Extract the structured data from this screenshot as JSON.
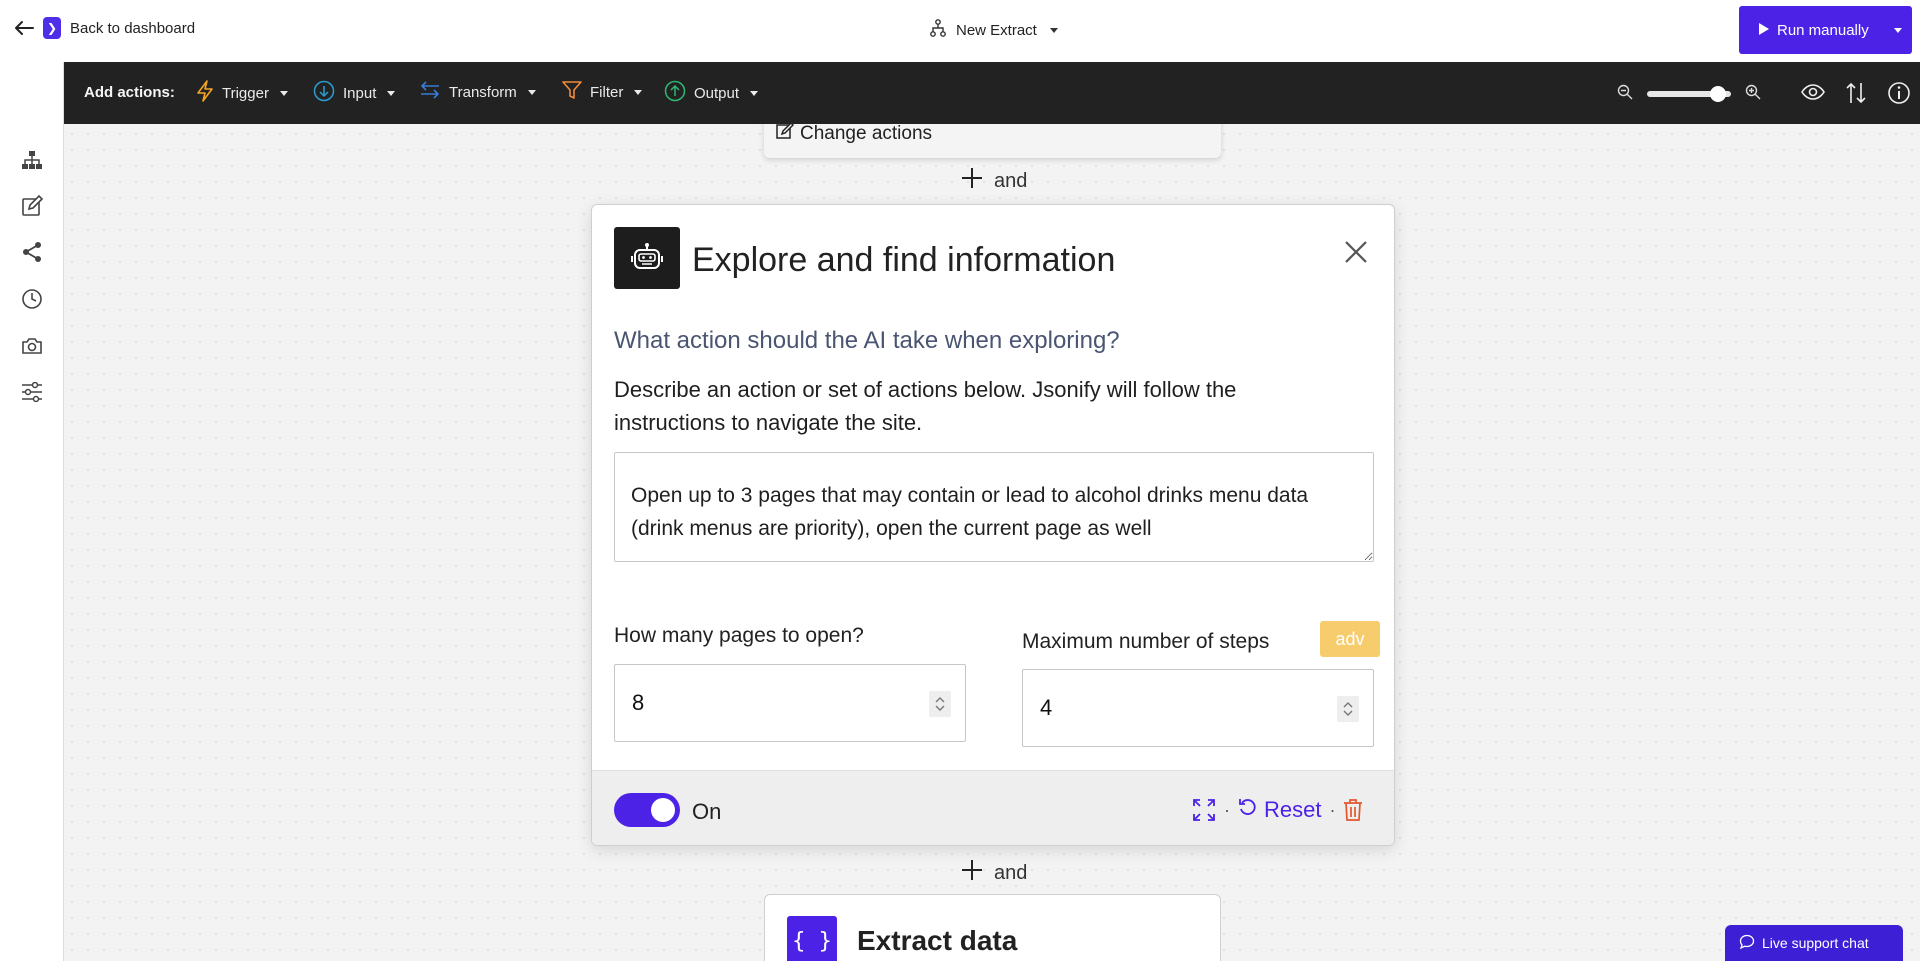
{
  "header": {
    "back_label": "Back to dashboard",
    "extract_name": "New Extract",
    "run_label": "Run manually"
  },
  "toolbar": {
    "add_actions_label": "Add actions:",
    "items": [
      {
        "label": "Trigger",
        "icon": "lightning-icon",
        "color": "#f5a623"
      },
      {
        "label": "Input",
        "icon": "arrow-down-circle-icon",
        "color": "#2a9fd6"
      },
      {
        "label": "Transform",
        "icon": "swap-arrows-icon",
        "color": "#3a7bd5"
      },
      {
        "label": "Filter",
        "icon": "funnel-icon",
        "color": "#f08c3a"
      },
      {
        "label": "Output",
        "icon": "arrow-up-circle-icon",
        "color": "#2eb872"
      }
    ],
    "zoom_level": 0.93
  },
  "sidebar": {
    "icons": [
      "hierarchy-icon",
      "edit-icon",
      "share-icon",
      "history-icon",
      "camera-icon",
      "settings-sliders-icon"
    ]
  },
  "canvas": {
    "prev_card_action": "Change actions",
    "and_label": "and"
  },
  "card": {
    "title": "Explore and find information",
    "question": "What action should the AI take when exploring?",
    "description": "Describe an action or set of actions below. Jsonify will follow the instructions to navigate the site.",
    "instructions": "Open up to 3 pages that may contain or lead to alcohol drinks menu data (drink menus are priority), open the current page as well",
    "pages_label": "How many pages to open?",
    "pages_value": "8",
    "steps_label": "Maximum number of steps",
    "steps_badge": "adv",
    "steps_value": "4",
    "toggle_label": "On",
    "toggle_on": true,
    "reset_label": "Reset",
    "separator": "·"
  },
  "extract_card": {
    "title": "Extract data",
    "icon_glyph": "{ }"
  },
  "live_chat": {
    "label": "Live support chat"
  },
  "colors": {
    "accent": "#4b22e6",
    "toolbar_bg": "#222222",
    "adv_badge": "#f7cc6d",
    "delete": "#e2552e"
  }
}
